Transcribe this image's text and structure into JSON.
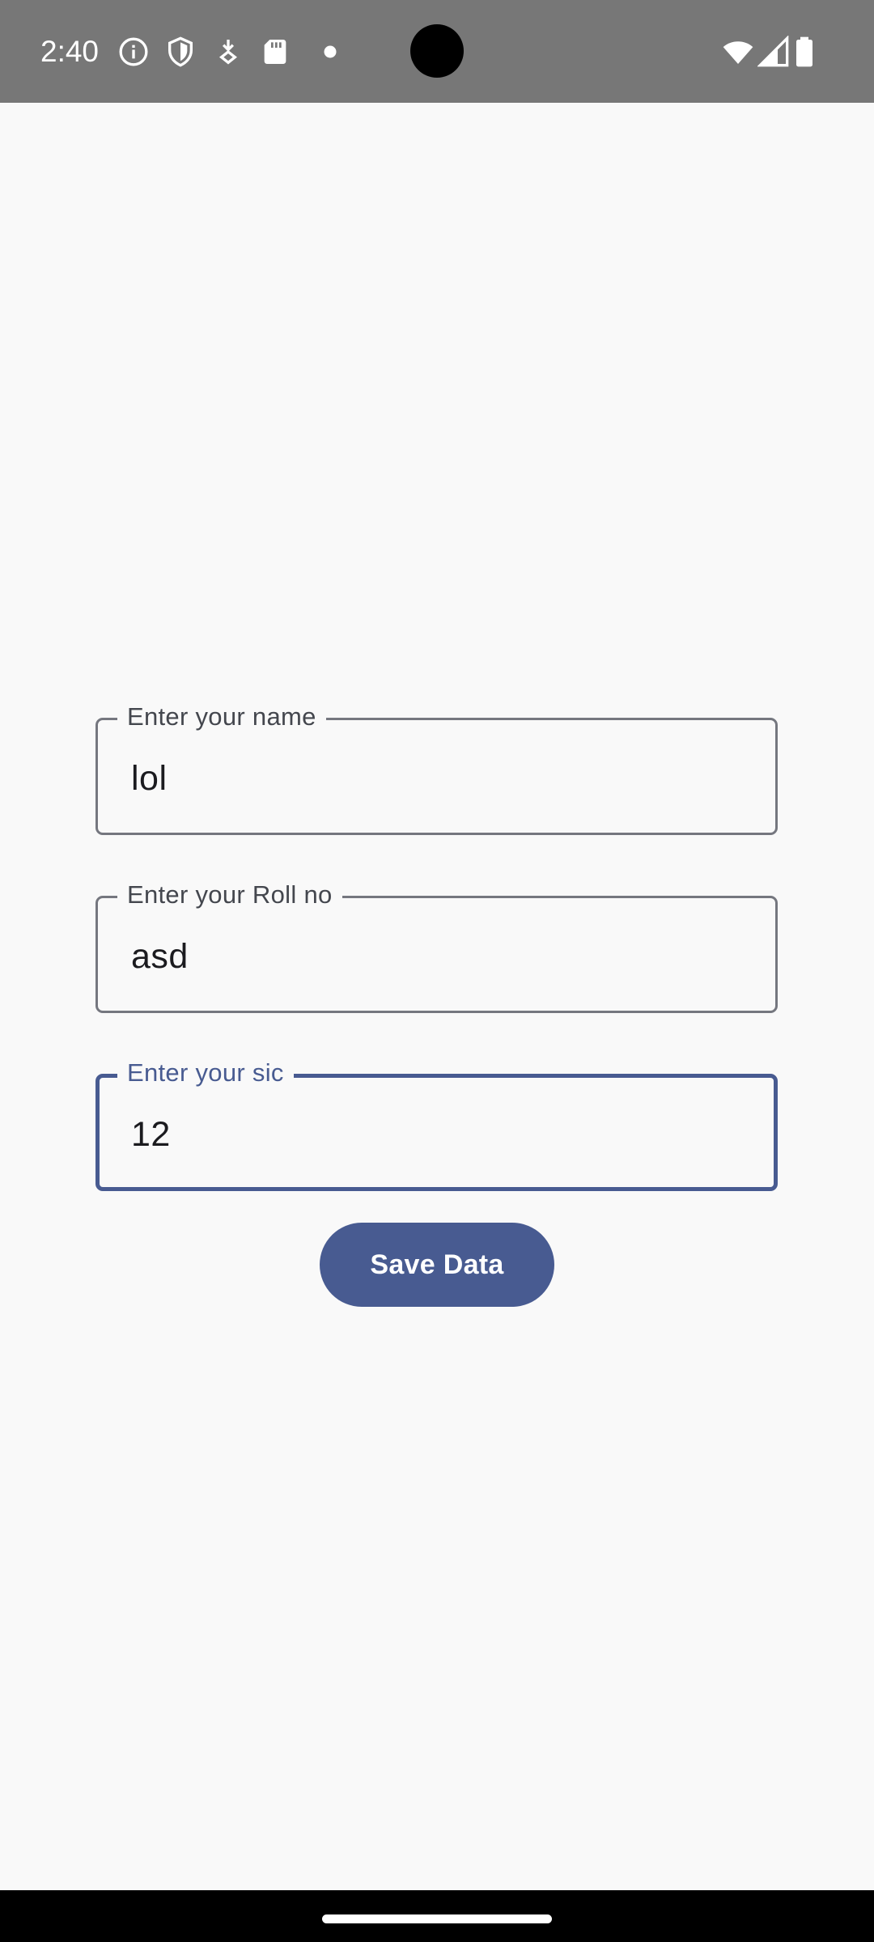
{
  "status_bar": {
    "time": "2:40",
    "icons": [
      "info-icon",
      "shield-icon",
      "download-icon",
      "sd-card-icon",
      "dot-icon",
      "wifi-icon",
      "signal-icon",
      "battery-icon"
    ]
  },
  "form": {
    "name_field": {
      "label": "Enter your name",
      "value": "lol"
    },
    "roll_field": {
      "label": "Enter your Roll no",
      "value": "asd"
    },
    "sic_field": {
      "label": "Enter your sic",
      "value": "12"
    },
    "save_label": "Save Data"
  },
  "colors": {
    "accent": "#485b91",
    "outline": "#75777f",
    "background": "#f9f9f9",
    "status_bar": "#777777"
  }
}
